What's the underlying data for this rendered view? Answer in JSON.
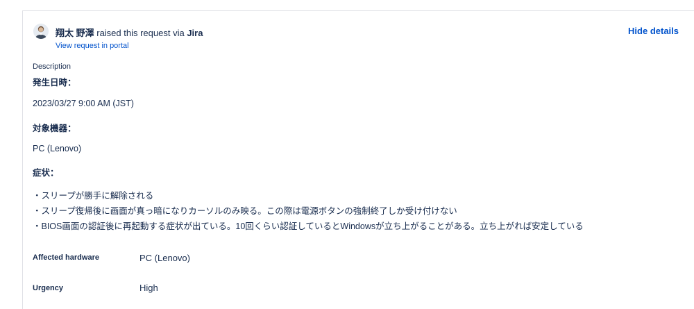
{
  "request": {
    "requester_name": "翔太 野澤",
    "raised_text": " raised this request via ",
    "channel": "Jira",
    "portal_link": "View request in portal",
    "hide_details": "Hide details"
  },
  "description": {
    "label": "Description",
    "heading_1": "発生日時：",
    "datetime": "2023/03/27 9:00 AM (JST)",
    "heading_2": "対象機器：",
    "device": "PC (Lenovo)",
    "heading_3": "症状：",
    "symptoms": [
      "・スリープが勝手に解除される",
      "・スリープ復帰後に画面が真っ暗になりカーソルのみ映る。この際は電源ボタンの強制終了しか受け付けない",
      "・BIOS画面の認証後に再起動する症状が出ている。10回くらい認証しているとWindowsが立ち上がることがある。立ち上がれば安定している"
    ]
  },
  "fields": [
    {
      "label": "Affected hardware",
      "value": "PC (Lenovo)"
    },
    {
      "label": "Urgency",
      "value": "High"
    }
  ],
  "colors": {
    "link": "#0052cc",
    "text": "#172b4d",
    "border": "#dfe1e6"
  },
  "icons": {
    "avatar": "user-avatar-icon"
  }
}
